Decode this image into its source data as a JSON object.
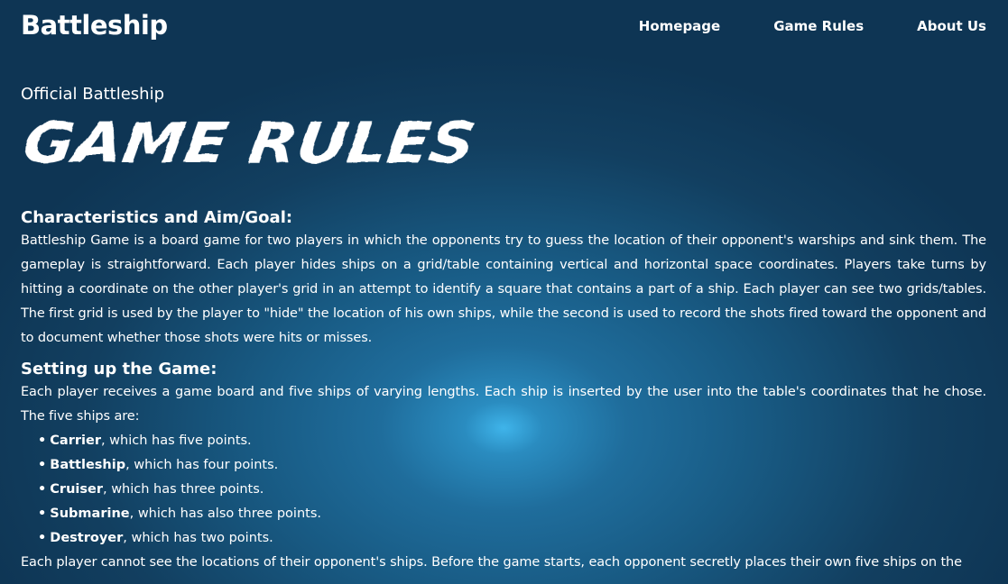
{
  "header": {
    "brand": "Battleship",
    "nav": {
      "homepage": "Homepage",
      "game_rules": "Game Rules",
      "about_us": "About Us"
    }
  },
  "main": {
    "subtitle": "Official Battleship",
    "title": "GAME RULES",
    "sections": [
      {
        "heading": "Characteristics and Aim/Goal:",
        "text": "Battleship Game is a board game for two players in which the opponents try to guess the location of their opponent's warships and sink them. The gameplay is straightforward. Each player hides ships on a grid/table containing vertical and horizontal space coordinates. Players take turns by hitting a coordinate on the other player's grid in an attempt to identify a square that contains a part of a ship. Each player can see two grids/tables. The first grid is used by the player to \"hide\" the location of his own ships, while the second is used to record the shots fired toward the opponent and to document whether those shots were hits or misses."
      },
      {
        "heading": "Setting up the Game:",
        "text": "Each player receives a game board and five ships of varying lengths. Each ship is inserted by the user into the table's coordinates that he chose. The five ships are:",
        "ships": [
          {
            "name": "Carrier",
            "desc": ", which has five points."
          },
          {
            "name": "Battleship",
            "desc": ", which has four points."
          },
          {
            "name": "Cruiser",
            "desc": ", which has three points."
          },
          {
            "name": "Submarine",
            "desc": ", which has also three points."
          },
          {
            "name": "Destroyer",
            "desc": ", which has two points."
          }
        ],
        "text_after": "Each player cannot see the locations of their opponent's ships. Before the game starts, each opponent secretly places their own five ships on the"
      }
    ]
  },
  "colors": {
    "background_dark": "#0e3554",
    "background_glow": "#3fb4ea",
    "text": "#ffffff"
  }
}
